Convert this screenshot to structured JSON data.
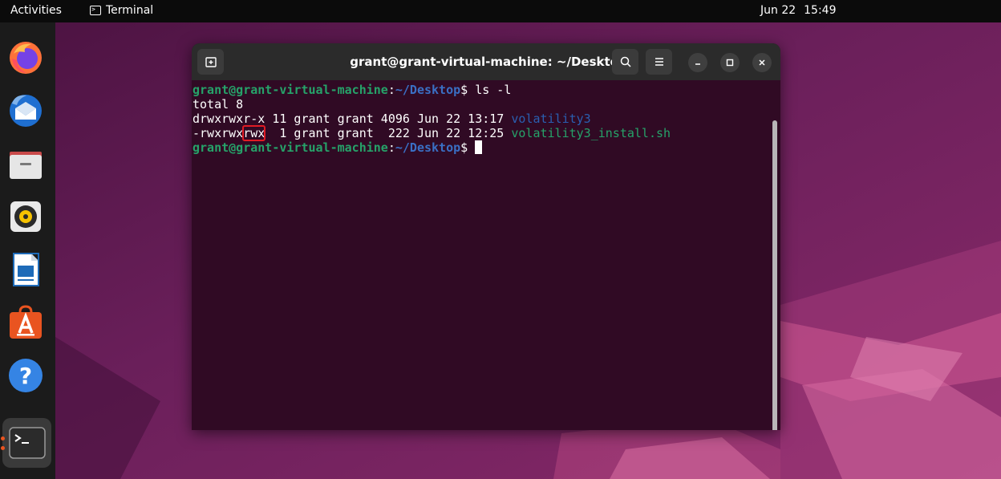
{
  "topbar": {
    "activities": "Activities",
    "app_name": "Terminal",
    "date": "Jun 22",
    "time": "15:49"
  },
  "dock": {
    "items": [
      {
        "name": "firefox",
        "icon": "firefox-icon"
      },
      {
        "name": "thunderbird",
        "icon": "thunderbird-icon"
      },
      {
        "name": "files",
        "icon": "files-icon"
      },
      {
        "name": "rhythmbox",
        "icon": "speaker-icon"
      },
      {
        "name": "libreoffice-writer",
        "icon": "document-icon"
      },
      {
        "name": "software",
        "icon": "app-store-icon"
      },
      {
        "name": "help",
        "icon": "help-icon"
      },
      {
        "name": "terminal",
        "icon": "terminal-icon",
        "active": true
      }
    ]
  },
  "window": {
    "title": "grant@grant-virtual-machine: ~/Desktop"
  },
  "terminal": {
    "prompt_user": "grant@grant-virtual-machine",
    "prompt_sep": ":",
    "prompt_path": "~/Desktop",
    "prompt_symbol": "$",
    "command": " ls -l",
    "total": "total 8",
    "row1_meta": "drwxrwxr-x 11 grant grant 4096 Jun 22 13:17 ",
    "row1_name": "volatility3",
    "row2_perm_a": "-rwxrwx",
    "row2_perm_b": "rwx",
    "row2_meta": "  1 grant grant  222 Jun 22 12:25 ",
    "row2_name": "volatility3_install.sh"
  },
  "colors": {
    "terminal_bg": "#300a24",
    "prompt_green": "#26a269",
    "path_blue": "#3a6fc4",
    "highlight_red": "#e01b24",
    "accent_orange": "#e95420"
  }
}
